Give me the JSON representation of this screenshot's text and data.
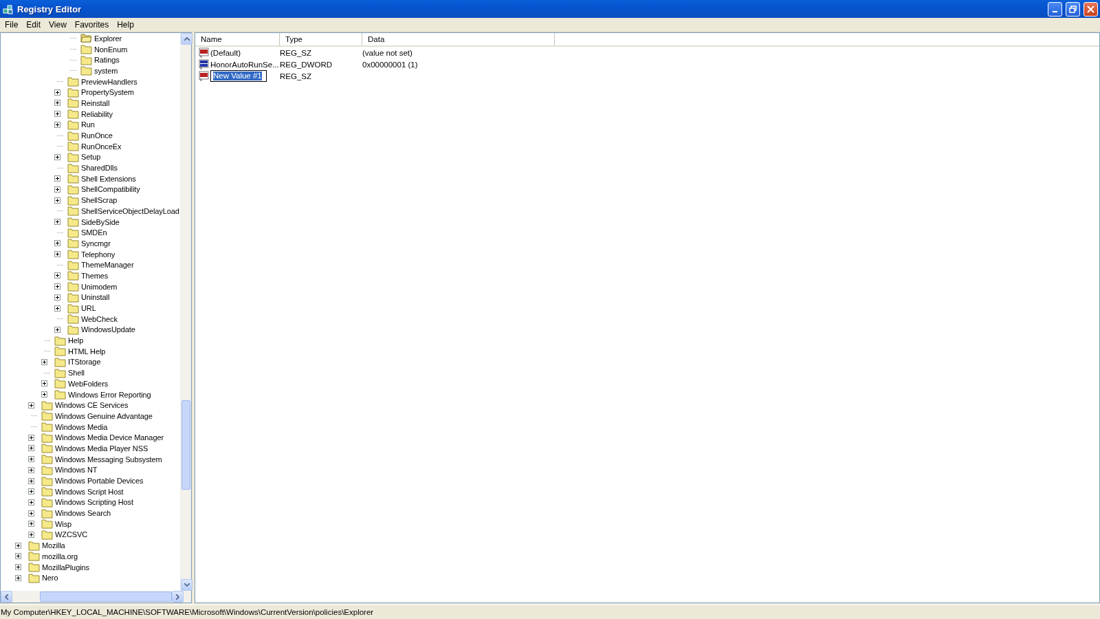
{
  "window": {
    "title": "Registry Editor"
  },
  "menu": [
    "File",
    "Edit",
    "View",
    "Favorites",
    "Help"
  ],
  "tree": {
    "items": [
      {
        "children": [
          {
            "children": [
              {
                "children": [
                  {
                    "children": [
                      {
                        "label": "Explorer",
                        "expandable": false,
                        "selected": true
                      },
                      {
                        "label": "NonEnum",
                        "expandable": false,
                        "selected": false
                      },
                      {
                        "label": "Ratings",
                        "expandable": false,
                        "selected": false
                      },
                      {
                        "label": "system",
                        "expandable": false,
                        "selected": false
                      }
                    ]
                  },
                  {
                    "label": "PreviewHandlers",
                    "expandable": false,
                    "selected": false
                  },
                  {
                    "label": "PropertySystem",
                    "expandable": true,
                    "selected": false
                  },
                  {
                    "label": "Reinstall",
                    "expandable": true,
                    "selected": false
                  },
                  {
                    "label": "Reliability",
                    "expandable": true,
                    "selected": false
                  },
                  {
                    "label": "Run",
                    "expandable": true,
                    "selected": false
                  },
                  {
                    "label": "RunOnce",
                    "expandable": false,
                    "selected": false
                  },
                  {
                    "label": "RunOnceEx",
                    "expandable": false,
                    "selected": false
                  },
                  {
                    "label": "Setup",
                    "expandable": true,
                    "selected": false
                  },
                  {
                    "label": "SharedDlls",
                    "expandable": false,
                    "selected": false
                  },
                  {
                    "label": "Shell Extensions",
                    "expandable": true,
                    "selected": false
                  },
                  {
                    "label": "ShellCompatibility",
                    "expandable": true,
                    "selected": false
                  },
                  {
                    "label": "ShellScrap",
                    "expandable": true,
                    "selected": false
                  },
                  {
                    "label": "ShellServiceObjectDelayLoad",
                    "expandable": false,
                    "selected": false
                  },
                  {
                    "label": "SideBySide",
                    "expandable": true,
                    "selected": false
                  },
                  {
                    "label": "SMDEn",
                    "expandable": false,
                    "selected": false
                  },
                  {
                    "label": "Syncmgr",
                    "expandable": true,
                    "selected": false
                  },
                  {
                    "label": "Telephony",
                    "expandable": true,
                    "selected": false
                  },
                  {
                    "label": "ThemeManager",
                    "expandable": false,
                    "selected": false
                  },
                  {
                    "label": "Themes",
                    "expandable": true,
                    "selected": false
                  },
                  {
                    "label": "Unimodem",
                    "expandable": true,
                    "selected": false
                  },
                  {
                    "label": "Uninstall",
                    "expandable": true,
                    "selected": false
                  },
                  {
                    "label": "URL",
                    "expandable": true,
                    "selected": false
                  },
                  {
                    "label": "WebCheck",
                    "expandable": false,
                    "selected": false
                  },
                  {
                    "label": "WindowsUpdate",
                    "expandable": true,
                    "selected": false
                  }
                ]
              },
              {
                "label": "Help",
                "expandable": false,
                "selected": false
              },
              {
                "label": "HTML Help",
                "expandable": false,
                "selected": false
              },
              {
                "label": "ITStorage",
                "expandable": true,
                "selected": false
              },
              {
                "label": "Shell",
                "expandable": false,
                "selected": false
              },
              {
                "label": "WebFolders",
                "expandable": true,
                "selected": false
              },
              {
                "label": "Windows Error Reporting",
                "expandable": true,
                "selected": false
              }
            ]
          },
          {
            "label": "Windows CE Services",
            "expandable": true,
            "selected": false
          },
          {
            "label": "Windows Genuine Advantage",
            "expandable": false,
            "selected": false
          },
          {
            "label": "Windows Media",
            "expandable": false,
            "selected": false
          },
          {
            "label": "Windows Media Device Manager",
            "expandable": true,
            "selected": false
          },
          {
            "label": "Windows Media Player NSS",
            "expandable": true,
            "selected": false
          },
          {
            "label": "Windows Messaging Subsystem",
            "expandable": true,
            "selected": false
          },
          {
            "label": "Windows NT",
            "expandable": true,
            "selected": false
          },
          {
            "label": "Windows Portable Devices",
            "expandable": true,
            "selected": false
          },
          {
            "label": "Windows Script Host",
            "expandable": true,
            "selected": false
          },
          {
            "label": "Windows Scripting Host",
            "expandable": true,
            "selected": false
          },
          {
            "label": "Windows Search",
            "expandable": true,
            "selected": false
          },
          {
            "label": "Wisp",
            "expandable": true,
            "selected": false
          },
          {
            "label": "WZCSVC",
            "expandable": true,
            "selected": false
          }
        ]
      },
      {
        "label": "Mozilla",
        "expandable": true,
        "selected": false
      },
      {
        "label": "mozilla.org",
        "expandable": true,
        "selected": false
      },
      {
        "label": "MozillaPlugins",
        "expandable": true,
        "selected": false
      },
      {
        "label": "Nero",
        "expandable": true,
        "selected": false
      }
    ]
  },
  "values": {
    "columns": [
      "Name",
      "Type",
      "Data"
    ],
    "rows": [
      {
        "kind": "string",
        "name": "(Default)",
        "type": "REG_SZ",
        "data": "(value not set)",
        "editing": false
      },
      {
        "kind": "binary",
        "name": "HonorAutoRunSe...",
        "type": "REG_DWORD",
        "data": "0x00000001 (1)",
        "editing": false
      },
      {
        "kind": "string",
        "name": "New Value #1",
        "type": "REG_SZ",
        "editing": true
      }
    ]
  },
  "status_bar": "My Computer\\HKEY_LOCAL_MACHINE\\SOFTWARE\\Microsoft\\Windows\\CurrentVersion\\policies\\Explorer"
}
